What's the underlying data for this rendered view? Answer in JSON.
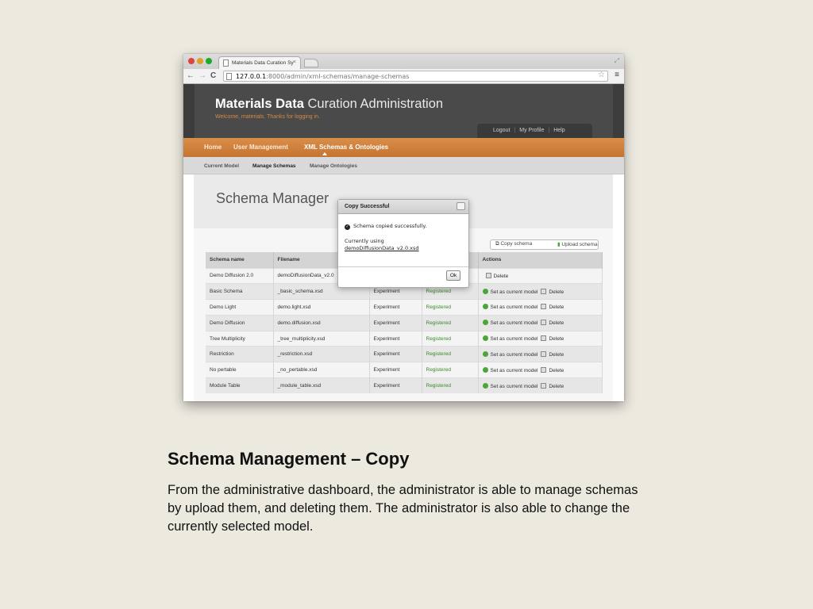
{
  "browser": {
    "tab_title": "Materials Data Curation Sy",
    "url_host": "127.0.0.1",
    "url_rest": ":8000/admin/xml-schemas/manage-schemas"
  },
  "header": {
    "title_bold": "Materials Data",
    "title_light": "Curation Administration",
    "welcome": "Welcome, materials. Thanks for logging in.",
    "links": [
      "Logout",
      "My Profile",
      "Help"
    ]
  },
  "main_nav": [
    "Home",
    "User Management",
    "XML Schemas & Ontologies"
  ],
  "sub_nav": [
    "Current Model",
    "Manage Schemas",
    "Manage Ontologies"
  ],
  "page_title": "Schema Manager",
  "actions": {
    "copy": "Copy schema",
    "upload": "Upload schema"
  },
  "table": {
    "headers": [
      "Schema name",
      "Filename",
      "",
      "",
      "Actions"
    ],
    "rows": [
      {
        "name": "Demo Diffusion 2.0",
        "file": "demoDiffusionData_v2.0",
        "type": "",
        "status": "",
        "set": "",
        "del": "Delete"
      },
      {
        "name": "Basic Schema",
        "file": "_basic_schema.xsd",
        "type": "Experiment",
        "status": "Registered",
        "set": "Set as current model",
        "del": "Delete"
      },
      {
        "name": "Demo Light",
        "file": "demo.light.xsd",
        "type": "Experiment",
        "status": "Registered",
        "set": "Set as current model",
        "del": "Delete"
      },
      {
        "name": "Demo Diffusion",
        "file": "demo.diffusion.xsd",
        "type": "Experiment",
        "status": "Registered",
        "set": "Set as current model",
        "del": "Delete"
      },
      {
        "name": "Tree Multiplicity",
        "file": "_tree_multiplicity.xsd",
        "type": "Experiment",
        "status": "Registered",
        "set": "Set as current model",
        "del": "Delete"
      },
      {
        "name": "Restriction",
        "file": "_restriction.xsd",
        "type": "Experiment",
        "status": "Registered",
        "set": "Set as current model",
        "del": "Delete"
      },
      {
        "name": "No pertable",
        "file": "_no_pertable.xsd",
        "type": "Experiment",
        "status": "Registered",
        "set": "Set as current model",
        "del": "Delete"
      },
      {
        "name": "Module Table",
        "file": "_module_table.xsd",
        "type": "Experiment",
        "status": "Registered",
        "set": "Set as current model",
        "del": "Delete"
      }
    ]
  },
  "dialog": {
    "title": "Copy Successful",
    "message": "Schema copied successfully.",
    "using": "Currently using",
    "file": "demoDiffusionData_v2.0.xsd",
    "ok": "Ok"
  },
  "slide": {
    "title": "Schema Management – Copy",
    "body": "From the administrative dashboard, the administrator is able to manage schemas by upload them, and deleting them.  The administrator is also able to change the currently selected model."
  }
}
